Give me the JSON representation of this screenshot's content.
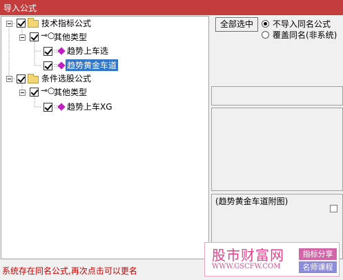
{
  "window": {
    "title": "导入公式"
  },
  "tree": {
    "groups": [
      {
        "label": "技术指标公式",
        "subgroup": "其他类型",
        "items": [
          "趋势上车选",
          "趋势黄金车道"
        ]
      },
      {
        "label": "条件选股公式",
        "subgroup": "其他类型",
        "items": [
          "趋势上车XG"
        ]
      }
    ],
    "selected_item": "趋势黄金车道"
  },
  "options": {
    "select_all_label": "全部选中",
    "radio_skip_label": "不导入同名公式",
    "radio_overwrite_label": "覆盖同名(非系统)",
    "selected_radio": "不导入同名公式"
  },
  "preview": {
    "title": "(趋势黄金车道附图)"
  },
  "status": {
    "message": "系统存在同名公式,再次点击可以更名"
  },
  "watermark": {
    "site_name": "股市财富网",
    "url": "WWW.GSCFW.COM",
    "tag1": "指标分享",
    "tag2": "名师课程"
  },
  "colors": {
    "titlebar": "#c43c3c",
    "selection": "#3276c9",
    "status_text": "#d00000"
  }
}
